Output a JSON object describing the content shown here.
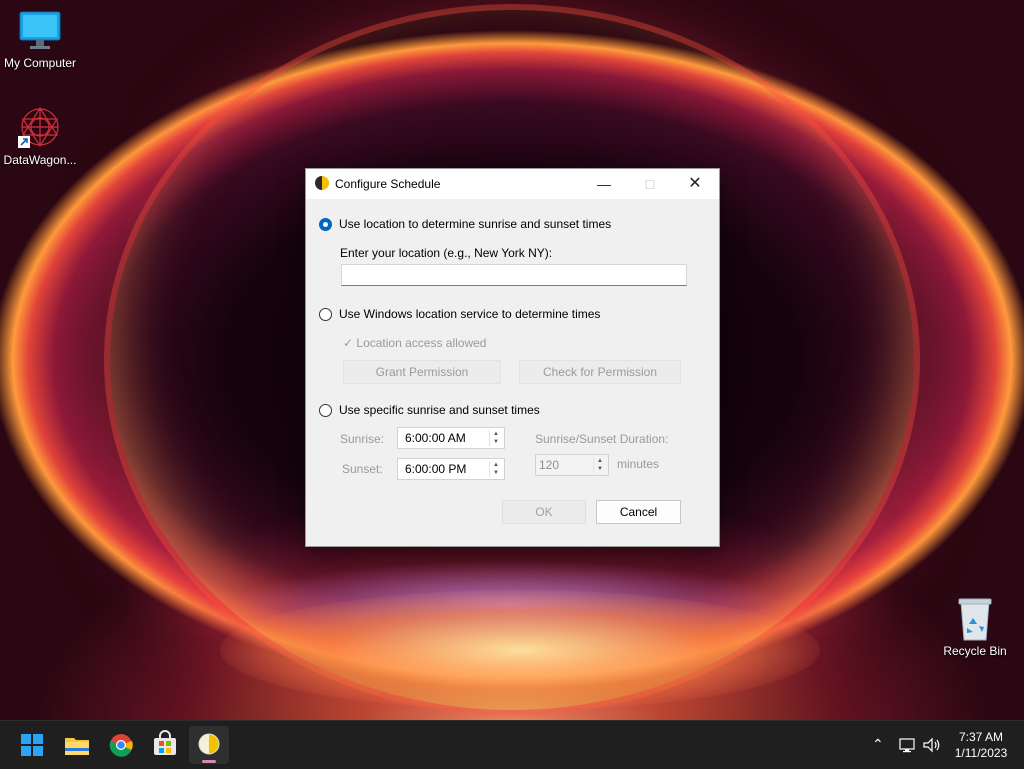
{
  "desktop": {
    "icons": [
      {
        "label": "My Computer",
        "icon": "monitor-icon"
      },
      {
        "label": "DataWagon...",
        "icon": "datawagon-icon"
      },
      {
        "label": "Recycle Bin",
        "icon": "recycle-bin-icon"
      }
    ]
  },
  "dialog": {
    "title": "Configure Schedule",
    "options": {
      "location": {
        "label": "Use location to determine sunrise and sunset times",
        "checked": true
      },
      "windows_service": {
        "label": "Use Windows location service to determine times",
        "checked": false
      },
      "specific": {
        "label": "Use specific sunrise and sunset times",
        "checked": false
      }
    },
    "location_prompt": "Enter your location (e.g., New York NY):",
    "location_value": "",
    "access_status": "✓ Location access allowed",
    "grant_button": "Grant Permission",
    "check_button": "Check for Permission",
    "sunrise_label": "Sunrise:",
    "sunrise_value": "6:00:00 AM",
    "sunset_label": "Sunset:",
    "sunset_value": "6:00:00 PM",
    "duration_label": "Sunrise/Sunset Duration:",
    "duration_value": "120",
    "duration_unit": "minutes",
    "ok_button": "OK",
    "cancel_button": "Cancel"
  },
  "taskbar": {
    "apps": [
      "start-icon",
      "file-explorer-icon",
      "chrome-icon",
      "store-icon",
      "app-icon"
    ],
    "time": "7:37 AM",
    "date": "1/11/2023"
  },
  "colors": {
    "accent": "#0067c0",
    "taskbar": "#1f1f1f",
    "dialog_bg": "#f0f0f0"
  }
}
